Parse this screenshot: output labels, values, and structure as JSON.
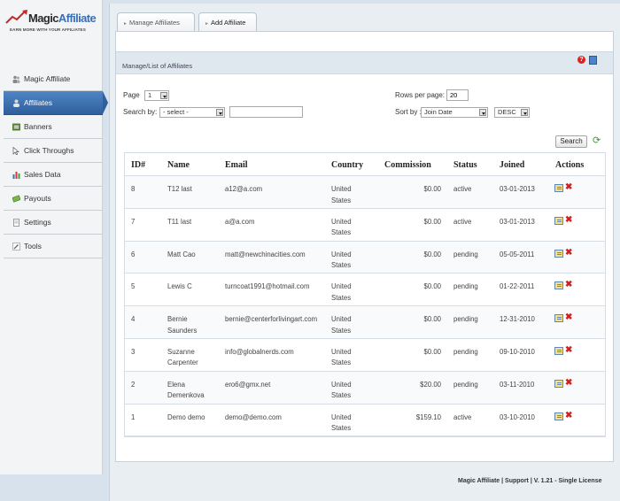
{
  "brand": {
    "name_part1": "Magic",
    "name_part2": "Affiliate",
    "tagline": "EARN MORE WITH YOUR AFFILIATES"
  },
  "sidebar": {
    "items": [
      {
        "label": "Magic Affiliate",
        "icon": "people-icon"
      },
      {
        "label": "Affiliates",
        "icon": "person-icon"
      },
      {
        "label": "Banners",
        "icon": "banner-icon"
      },
      {
        "label": "Click Throughs",
        "icon": "cursor-icon"
      },
      {
        "label": "Sales Data",
        "icon": "bar-chart-icon"
      },
      {
        "label": "Payouts",
        "icon": "money-icon"
      },
      {
        "label": "Settings",
        "icon": "document-icon"
      },
      {
        "label": "Tools",
        "icon": "wrench-icon"
      }
    ],
    "active_index": 1
  },
  "tabs": [
    {
      "label": "Manage Affiliates"
    },
    {
      "label": "Add Affiliate"
    }
  ],
  "panel": {
    "title": "Manage/List of Affiliates",
    "help_icon_glyph": "?"
  },
  "controls": {
    "page_label": "Page",
    "page_value": "1",
    "rows_label": "Rows per page:",
    "rows_value": "20",
    "search_label": "Search by:",
    "search_by_value": "- select -",
    "search_text": "",
    "sort_label": "Sort by :",
    "sort_value": "Join Date",
    "order_value": "DESC",
    "search_button": "Search"
  },
  "table": {
    "columns": [
      "ID#",
      "Name",
      "Email",
      "Country",
      "Commission",
      "Status",
      "Joined",
      "Actions"
    ],
    "rows": [
      {
        "id": "8",
        "name": "T12 last",
        "email": "a12@a.com",
        "country": "United\nStates",
        "commission": "$0.00",
        "status": "active",
        "joined": "03-01-2013"
      },
      {
        "id": "7",
        "name": "T11 last",
        "email": "a@a.com",
        "country": "United\nStates",
        "commission": "$0.00",
        "status": "active",
        "joined": "03-01-2013"
      },
      {
        "id": "6",
        "name": "Matt Cao",
        "email": "matt@newchinacities.com",
        "country": "United\nStates",
        "commission": "$0.00",
        "status": "pending",
        "joined": "05-05-2011"
      },
      {
        "id": "5",
        "name": "Lewis C",
        "email": "turncoat1991@hotmail.com",
        "country": "United\nStates",
        "commission": "$0.00",
        "status": "pending",
        "joined": "01-22-2011"
      },
      {
        "id": "4",
        "name": "Bernie\nSaunders",
        "email": "bernie@centerforlivingart.com",
        "country": "United\nStates",
        "commission": "$0.00",
        "status": "pending",
        "joined": "12-31-2010"
      },
      {
        "id": "3",
        "name": "Suzanne\nCarpenter",
        "email": "info@globalnerds.com",
        "country": "United\nStates",
        "commission": "$0.00",
        "status": "pending",
        "joined": "09-10-2010"
      },
      {
        "id": "2",
        "name": "Elena\nDemenkova",
        "email": "ero6@gmx.net",
        "country": "United\nStates",
        "commission": "$20.00",
        "status": "pending",
        "joined": "03-11-2010"
      },
      {
        "id": "1",
        "name": "Demo demo",
        "email": "demo@demo.com",
        "country": "United\nStates",
        "commission": "$159.10",
        "status": "active",
        "joined": "03-10-2010"
      }
    ]
  },
  "footer": {
    "text": "Magic Affiliate | Support | V. 1.21 - Single License"
  },
  "colors": {
    "accent": "#3a6fb4",
    "active_nav": "#2f5f9c",
    "delete": "#d12020"
  }
}
